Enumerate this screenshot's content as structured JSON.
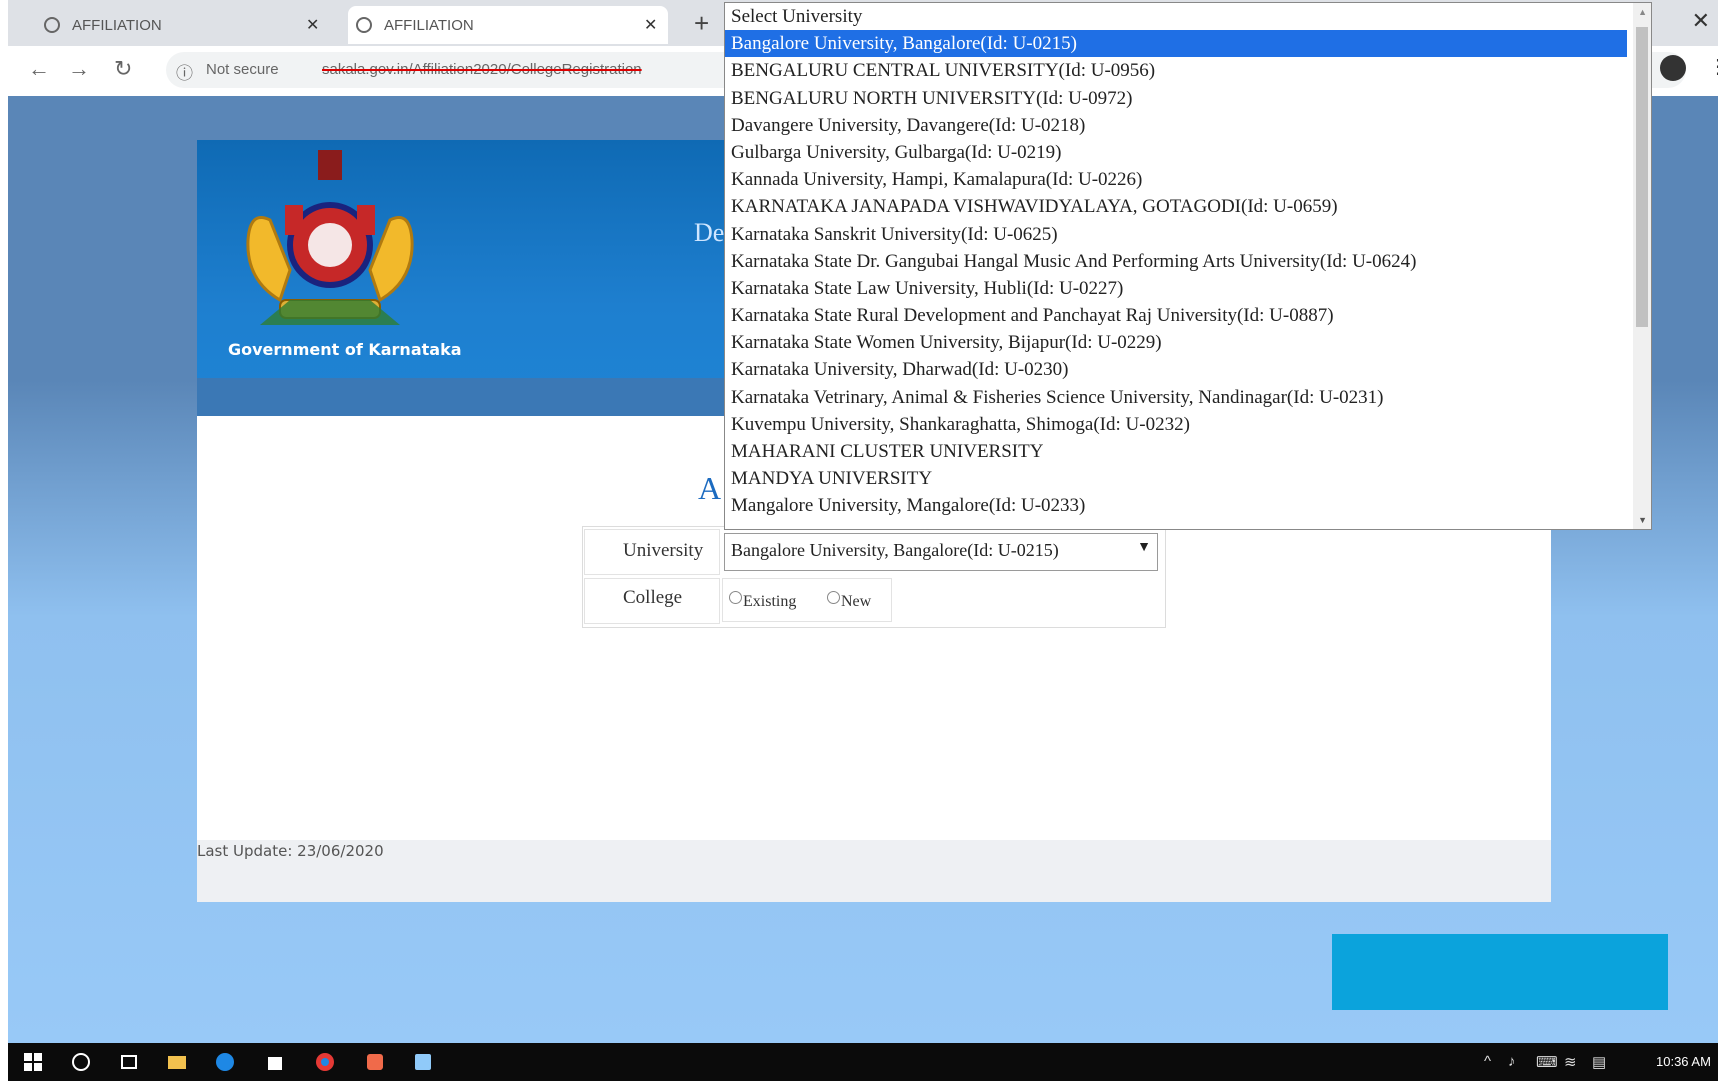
{
  "browser": {
    "tabs": [
      {
        "title": "AFFILIATION"
      },
      {
        "title": "AFFILIATION"
      }
    ],
    "new_tab_symbol": "+",
    "close_symbol": "✕",
    "address_bar": {
      "security_label": "Not secure",
      "url": "sakala.gov.in/Affiliation2020/CollegeRegistration"
    }
  },
  "header": {
    "org_name": "Government of Karnataka",
    "partial_title": "De"
  },
  "main": {
    "partial_heading": "A",
    "form": {
      "university_label": "University",
      "university_selected": "Bangalore University, Bangalore(Id: U-0215)",
      "college_label": "College",
      "college_options": [
        "Existing",
        "New"
      ]
    }
  },
  "footer": {
    "last_update": "Last Update: 23/06/2020"
  },
  "dropdown": {
    "options": [
      "Select University",
      "Bangalore University, Bangalore(Id: U-0215)",
      "BENGALURU CENTRAL UNIVERSITY(Id: U-0956)",
      "BENGALURU NORTH UNIVERSITY(Id: U-0972)",
      "Davangere University, Davangere(Id: U-0218)",
      "Gulbarga University, Gulbarga(Id: U-0219)",
      "Kannada University, Hampi, Kamalapura(Id: U-0226)",
      "KARNATAKA JANAPADA VISHWAVIDYALAYA, GOTAGODI(Id: U-0659)",
      "Karnataka Sanskrit University(Id: U-0625)",
      "Karnataka State Dr. Gangubai Hangal Music And Performing Arts University(Id: U-0624)",
      "Karnataka State Law University, Hubli(Id: U-0227)",
      "Karnataka State Rural Development and Panchayat Raj University(Id: U-0887)",
      "Karnataka State Women University, Bijapur(Id: U-0229)",
      "Karnataka University, Dharwad(Id: U-0230)",
      "Karnataka Vetrinary, Animal & Fisheries Science University, Nandinagar(Id: U-0231)",
      "Kuvempu University, Shankaraghatta, Shimoga(Id: U-0232)",
      "MAHARANI CLUSTER UNIVERSITY",
      "MANDYA UNIVERSITY",
      "Mangalore University, Mangalore(Id: U-0233)"
    ],
    "selected_index": 1
  },
  "taskbar": {
    "clock": "10:36 AM"
  },
  "colors": {
    "header_blue": "#1e7fcf",
    "selection_blue": "#1f6fe5",
    "cyan_block": "#0ba3dc"
  }
}
